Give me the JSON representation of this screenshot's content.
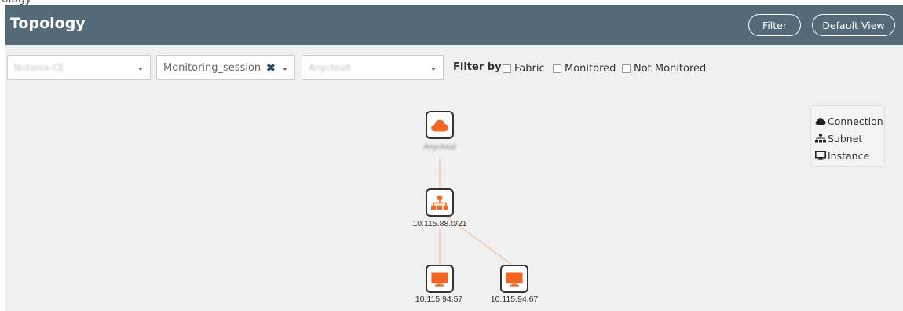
{
  "header": {
    "title": "Topology",
    "filter_label": "Filter",
    "default_view_label": "Default View"
  },
  "filters": {
    "select_1": "Nutanix-CE",
    "select_2": "Monitoring_session",
    "select_3": "Anycloud",
    "filter_by_label": "Filter by:",
    "checkboxes": [
      {
        "label": "Fabric",
        "checked": false
      },
      {
        "label": "Monitored",
        "checked": false
      },
      {
        "label": "Not Monitored",
        "checked": false
      }
    ]
  },
  "legend": {
    "items": [
      {
        "label": "Connection",
        "icon": "cloud-icon"
      },
      {
        "label": "Subnet",
        "icon": "sitemap-icon"
      },
      {
        "label": "Instance",
        "icon": "desktop-icon"
      }
    ]
  },
  "topology": {
    "connection": {
      "label": "Anycloud",
      "icon": "cloud-icon"
    },
    "subnet": {
      "label": "10.115.88.0/21",
      "icon": "sitemap-icon"
    },
    "instances": [
      {
        "label": "10.115.94.57",
        "icon": "desktop-icon"
      },
      {
        "label": "10.115.94.67",
        "icon": "desktop-icon"
      }
    ]
  },
  "colors": {
    "header_bg": "#546a78",
    "accent_orange": "#f26522",
    "canvas_bg": "#f0f0f0"
  }
}
